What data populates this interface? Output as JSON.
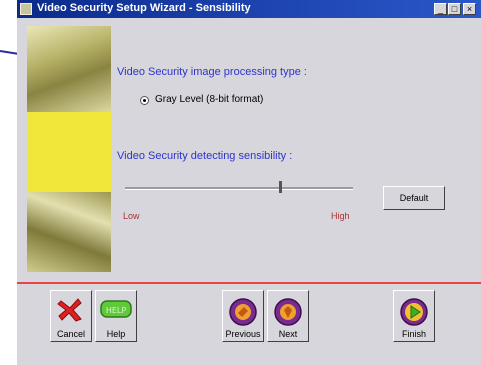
{
  "window": {
    "title": "Video Security Setup Wizard - Sensibility"
  },
  "sections": {
    "processing_label": "Video Security image processing type :",
    "processing_option": "Gray Level  (8-bit format)",
    "sensitivity_label": "Video Security detecting sensibility :"
  },
  "slider": {
    "low_label": "Low",
    "high_label": "High",
    "value_fraction": 0.68
  },
  "buttons": {
    "default_label": "Default",
    "cancel_label": "Cancel",
    "help_label": "Help",
    "previous_label": "Previous",
    "next_label": "Next",
    "finish_label": "Finish",
    "help_icon_text": "HELP"
  },
  "colors": {
    "title_bar": "#1f47b4",
    "label_blue": "#2f34c9",
    "divider_red": "#e24646",
    "range_red": "#aa3333",
    "leader_line": "#2d2a9a"
  },
  "icons": {
    "cancel": "red-x-icon",
    "help": "green-help-icon",
    "previous": "purple-orb-icon",
    "next": "purple-orb-icon",
    "finish": "green-arrow-orb-icon"
  }
}
